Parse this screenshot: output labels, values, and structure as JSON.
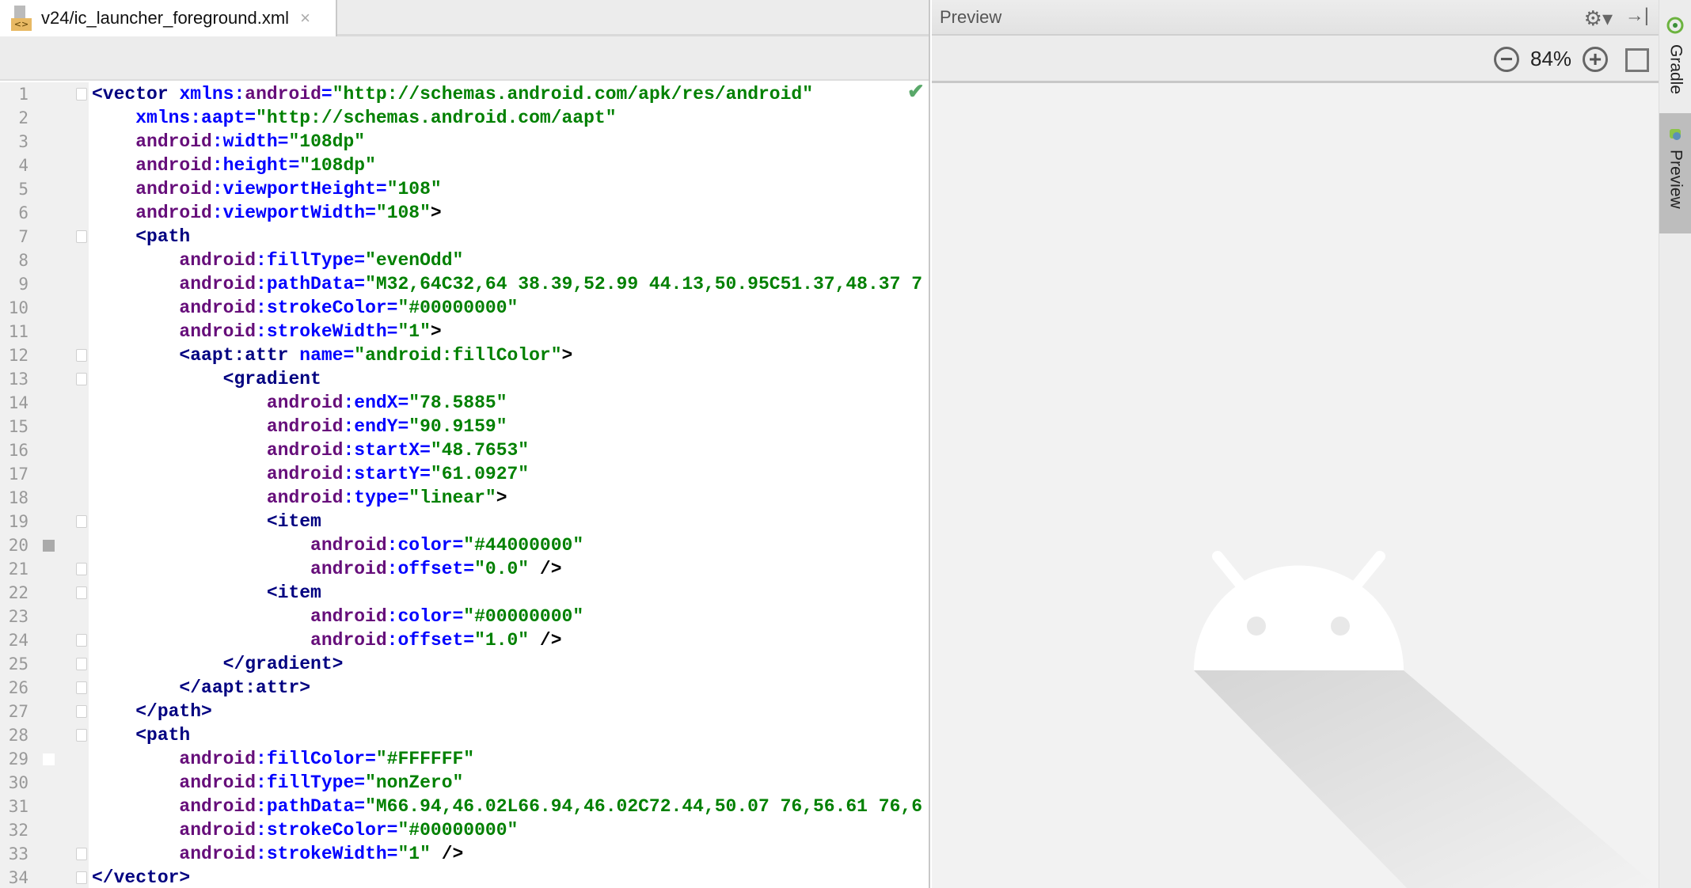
{
  "editor": {
    "tab_label": "v24/ic_launcher_foreground.xml",
    "tab_icon": "xml-file-icon",
    "tab_close": "×",
    "check": "✔",
    "lines": [
      {
        "n": "1",
        "indent": 0,
        "fold": true,
        "tokens": [
          [
            "t",
            "<vector"
          ],
          [
            "k",
            " "
          ],
          [
            "b",
            "xmlns:"
          ],
          [
            "p",
            "android"
          ],
          [
            "b",
            "="
          ],
          [
            "g",
            "\"http://schemas.android.com/apk/res/android\""
          ]
        ]
      },
      {
        "n": "2",
        "indent": 4,
        "tokens": [
          [
            "b",
            "xmlns:aapt="
          ],
          [
            "g",
            "\"http://schemas.android.com/aapt\""
          ]
        ]
      },
      {
        "n": "3",
        "indent": 4,
        "tokens": [
          [
            "p",
            "android"
          ],
          [
            "b",
            ":width="
          ],
          [
            "g",
            "\"108dp\""
          ]
        ]
      },
      {
        "n": "4",
        "indent": 4,
        "tokens": [
          [
            "p",
            "android"
          ],
          [
            "b",
            ":height="
          ],
          [
            "g",
            "\"108dp\""
          ]
        ]
      },
      {
        "n": "5",
        "indent": 4,
        "tokens": [
          [
            "p",
            "android"
          ],
          [
            "b",
            ":viewportHeight="
          ],
          [
            "g",
            "\"108\""
          ]
        ]
      },
      {
        "n": "6",
        "indent": 4,
        "tokens": [
          [
            "p",
            "android"
          ],
          [
            "b",
            ":viewportWidth="
          ],
          [
            "g",
            "\"108\""
          ],
          [
            "k",
            ">"
          ]
        ]
      },
      {
        "n": "7",
        "indent": 4,
        "fold": true,
        "tokens": [
          [
            "t",
            "<path"
          ]
        ]
      },
      {
        "n": "8",
        "indent": 8,
        "tokens": [
          [
            "p",
            "android"
          ],
          [
            "b",
            ":fillType="
          ],
          [
            "g",
            "\"evenOdd\""
          ]
        ]
      },
      {
        "n": "9",
        "indent": 8,
        "tokens": [
          [
            "p",
            "android"
          ],
          [
            "b",
            ":pathData="
          ],
          [
            "g",
            "\"M32,64C32,64 38.39,52.99 44.13,50.95C51.37,48.37 7"
          ]
        ]
      },
      {
        "n": "10",
        "indent": 8,
        "tokens": [
          [
            "p",
            "android"
          ],
          [
            "b",
            ":strokeColor="
          ],
          [
            "g",
            "\"#00000000\""
          ]
        ]
      },
      {
        "n": "11",
        "indent": 8,
        "tokens": [
          [
            "p",
            "android"
          ],
          [
            "b",
            ":strokeWidth="
          ],
          [
            "g",
            "\"1\""
          ],
          [
            "k",
            ">"
          ]
        ]
      },
      {
        "n": "12",
        "indent": 8,
        "fold": true,
        "tokens": [
          [
            "t",
            "<aapt:attr"
          ],
          [
            "k",
            " "
          ],
          [
            "b",
            "name="
          ],
          [
            "g",
            "\"android:fillColor\""
          ],
          [
            "k",
            ">"
          ]
        ]
      },
      {
        "n": "13",
        "indent": 12,
        "fold": true,
        "tokens": [
          [
            "t",
            "<gradient"
          ]
        ]
      },
      {
        "n": "14",
        "indent": 16,
        "tokens": [
          [
            "p",
            "android"
          ],
          [
            "b",
            ":endX="
          ],
          [
            "g",
            "\"78.5885\""
          ]
        ]
      },
      {
        "n": "15",
        "indent": 16,
        "tokens": [
          [
            "p",
            "android"
          ],
          [
            "b",
            ":endY="
          ],
          [
            "g",
            "\"90.9159\""
          ]
        ]
      },
      {
        "n": "16",
        "indent": 16,
        "tokens": [
          [
            "p",
            "android"
          ],
          [
            "b",
            ":startX="
          ],
          [
            "g",
            "\"48.7653\""
          ]
        ]
      },
      {
        "n": "17",
        "indent": 16,
        "tokens": [
          [
            "p",
            "android"
          ],
          [
            "b",
            ":startY="
          ],
          [
            "g",
            "\"61.0927\""
          ]
        ]
      },
      {
        "n": "18",
        "indent": 16,
        "tokens": [
          [
            "p",
            "android"
          ],
          [
            "b",
            ":type="
          ],
          [
            "g",
            "\"linear\""
          ],
          [
            "k",
            ">"
          ]
        ]
      },
      {
        "n": "19",
        "indent": 16,
        "fold": true,
        "tokens": [
          [
            "t",
            "<item"
          ]
        ]
      },
      {
        "n": "20",
        "indent": 20,
        "swatch": "#aaaaaa",
        "tokens": [
          [
            "p",
            "android"
          ],
          [
            "b",
            ":color="
          ],
          [
            "g",
            "\"#44000000\""
          ]
        ]
      },
      {
        "n": "21",
        "indent": 20,
        "fold": true,
        "tokens": [
          [
            "p",
            "android"
          ],
          [
            "b",
            ":offset="
          ],
          [
            "g",
            "\"0.0\""
          ],
          [
            "k",
            " />"
          ]
        ]
      },
      {
        "n": "22",
        "indent": 16,
        "fold": true,
        "tokens": [
          [
            "t",
            "<item"
          ]
        ]
      },
      {
        "n": "23",
        "indent": 20,
        "tokens": [
          [
            "p",
            "android"
          ],
          [
            "b",
            ":color="
          ],
          [
            "g",
            "\"#00000000\""
          ]
        ]
      },
      {
        "n": "24",
        "indent": 20,
        "fold": true,
        "tokens": [
          [
            "p",
            "android"
          ],
          [
            "b",
            ":offset="
          ],
          [
            "g",
            "\"1.0\""
          ],
          [
            "k",
            " />"
          ]
        ]
      },
      {
        "n": "25",
        "indent": 12,
        "fold": true,
        "tokens": [
          [
            "t",
            "</gradient>"
          ]
        ]
      },
      {
        "n": "26",
        "indent": 8,
        "fold": true,
        "tokens": [
          [
            "t",
            "</aapt:attr>"
          ]
        ]
      },
      {
        "n": "27",
        "indent": 4,
        "fold": true,
        "tokens": [
          [
            "t",
            "</path>"
          ]
        ]
      },
      {
        "n": "28",
        "indent": 4,
        "fold": true,
        "tokens": [
          [
            "t",
            "<path"
          ]
        ]
      },
      {
        "n": "29",
        "indent": 8,
        "swatch": "#FFFFFF",
        "tokens": [
          [
            "p",
            "android"
          ],
          [
            "b",
            ":fillColor="
          ],
          [
            "g",
            "\"#FFFFFF\""
          ]
        ]
      },
      {
        "n": "30",
        "indent": 8,
        "tokens": [
          [
            "p",
            "android"
          ],
          [
            "b",
            ":fillType="
          ],
          [
            "g",
            "\"nonZero\""
          ]
        ]
      },
      {
        "n": "31",
        "indent": 8,
        "tokens": [
          [
            "p",
            "android"
          ],
          [
            "b",
            ":pathData="
          ],
          [
            "g",
            "\"M66.94,46.02L66.94,46.02C72.44,50.07 76,56.61 76,6"
          ]
        ]
      },
      {
        "n": "32",
        "indent": 8,
        "tokens": [
          [
            "p",
            "android"
          ],
          [
            "b",
            ":strokeColor="
          ],
          [
            "g",
            "\"#00000000\""
          ]
        ]
      },
      {
        "n": "33",
        "indent": 8,
        "fold": true,
        "tokens": [
          [
            "p",
            "android"
          ],
          [
            "b",
            ":strokeWidth="
          ],
          [
            "g",
            "\"1\""
          ],
          [
            "k",
            " />"
          ]
        ]
      },
      {
        "n": "34",
        "indent": 0,
        "fold": true,
        "tokens": [
          [
            "t",
            "</vector>"
          ]
        ]
      }
    ]
  },
  "preview": {
    "title": "Preview",
    "zoom": "84%",
    "zoom_out": "−",
    "zoom_in": "+",
    "gear": "⚙▾",
    "hide": "→|"
  },
  "side_tabs": {
    "gradle": "Gradle",
    "preview": "Preview"
  },
  "colors": {
    "tag": "#000080",
    "attr": "#0000ff",
    "ns": "#660e7a",
    "value": "#008000"
  }
}
